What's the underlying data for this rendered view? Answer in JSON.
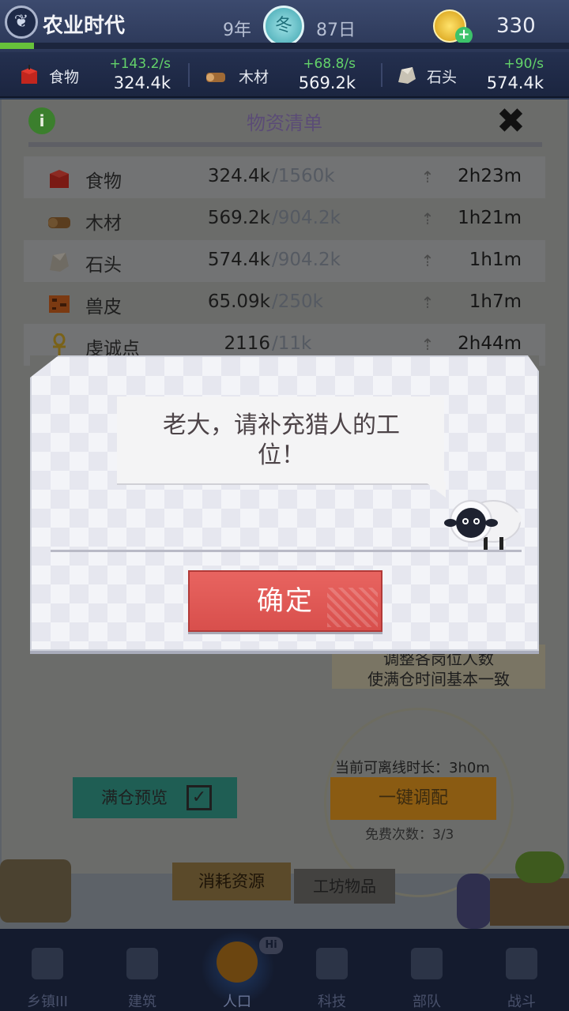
{
  "top_bar": {
    "era_title": "农业时代",
    "era_progress": 0.06,
    "year": "9年",
    "season": "冬",
    "day": "87日",
    "coins": "330"
  },
  "resources_strip": [
    {
      "name": "食物",
      "rate": "+143.2/s",
      "amount": "324.4k",
      "icon": "food-icon"
    },
    {
      "name": "木材",
      "rate": "+68.8/s",
      "amount": "569.2k",
      "icon": "wood-icon"
    },
    {
      "name": "石头",
      "rate": "+90/s",
      "amount": "574.4k",
      "icon": "stone-icon"
    }
  ],
  "panel": {
    "title": "物资清单",
    "rows": [
      {
        "name": "食物",
        "current": "324.4k",
        "cap": "/1560k",
        "time": "2h23m",
        "icon": "food-icon"
      },
      {
        "name": "木材",
        "current": "569.2k",
        "cap": "/904.2k",
        "time": "1h21m",
        "icon": "wood-icon"
      },
      {
        "name": "石头",
        "current": "574.4k",
        "cap": "/904.2k",
        "time": "1h1m",
        "icon": "stone-icon"
      },
      {
        "name": "兽皮",
        "current": "65.09k",
        "cap": "/250k",
        "time": "1h7m",
        "icon": "hide-icon"
      },
      {
        "name": "虔诚点",
        "current": "2116",
        "cap": "/11k",
        "time": "2h44m",
        "icon": "ankh-icon"
      }
    ],
    "hint_line1": "调整各岗位人数",
    "hint_line2": "使满仓时间基本一致",
    "offline_label": "当前可离线时长：3h0m",
    "oneclick_label": "一键调配",
    "free_count": "免费次数：3/3",
    "preview_label": "满仓预览",
    "tab_consume": "消耗资源",
    "tab_workshop": "工坊物品"
  },
  "dialog": {
    "message": "老大，请补充猎人的工位！",
    "confirm_label": "确定"
  },
  "bottom_nav": [
    {
      "label": "乡镇III",
      "icon": "town-icon",
      "active": false
    },
    {
      "label": "建筑",
      "icon": "house-icon",
      "active": false
    },
    {
      "label": "人口",
      "icon": "people-icon",
      "active": true
    },
    {
      "label": "科技",
      "icon": "book-icon",
      "active": false
    },
    {
      "label": "部队",
      "icon": "banner-icon",
      "active": false
    },
    {
      "label": "战斗",
      "icon": "swords-icon",
      "active": false
    }
  ],
  "hi_badge": "Hi",
  "colors": {
    "confirm_red": "#e25c59",
    "rate_green": "#63d36a",
    "dim_overlay": "#6b6c6a"
  }
}
